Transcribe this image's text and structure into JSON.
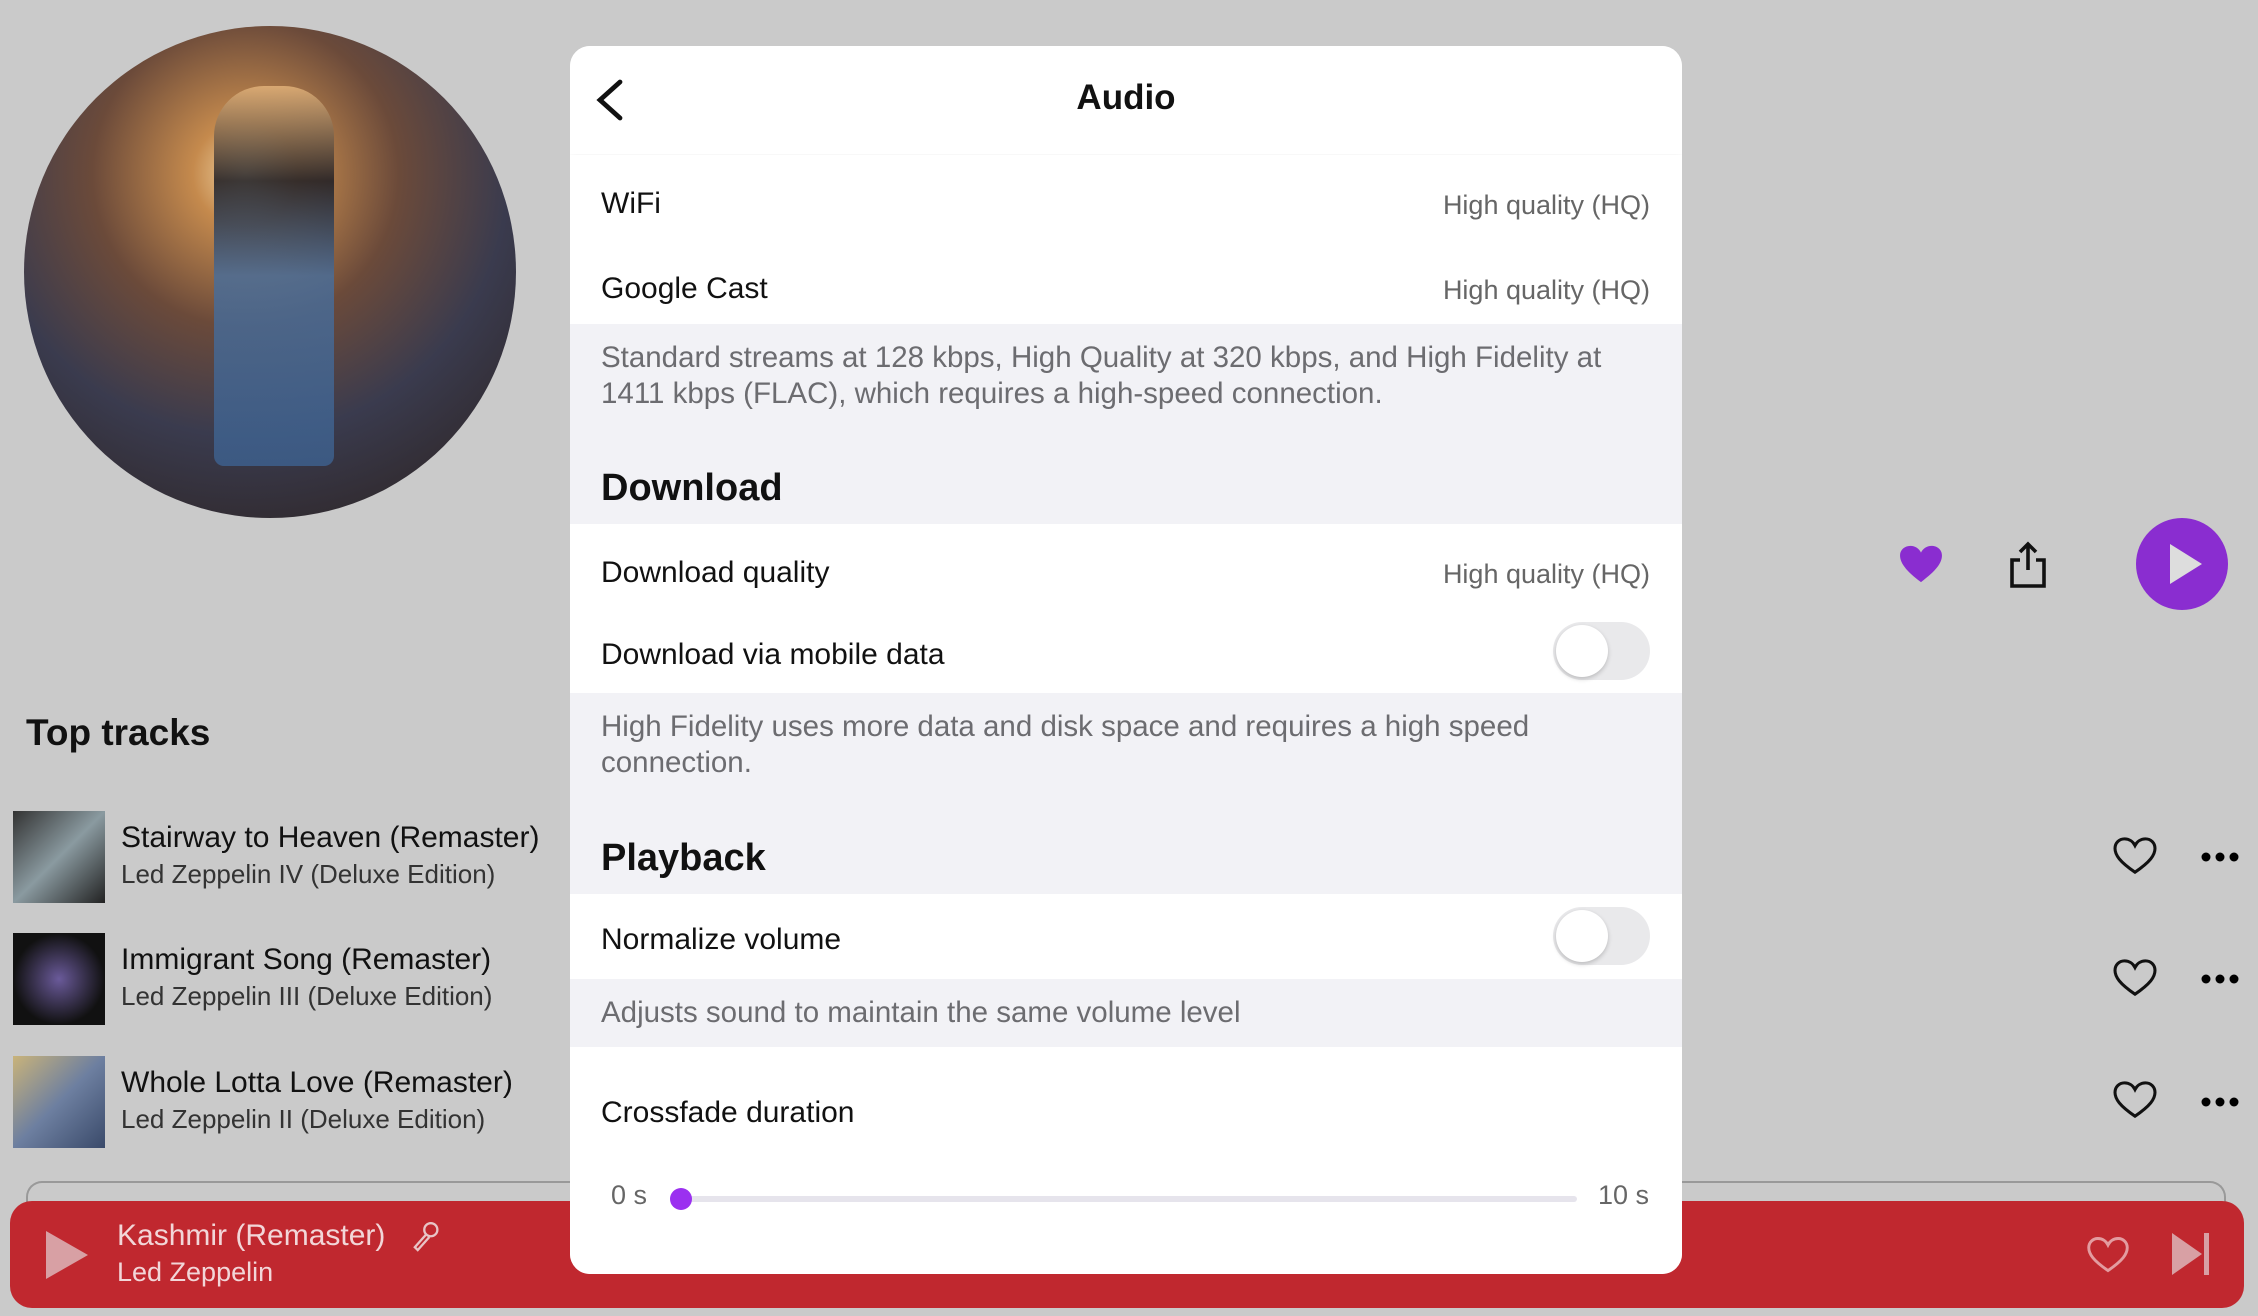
{
  "artist": {
    "actions": {
      "favorite_icon": "heart-filled",
      "share_icon": "share",
      "play_icon": "play"
    },
    "accent": "#8a2dd0"
  },
  "top_tracks": {
    "title": "Top tracks",
    "items": [
      {
        "title": "Stairway to Heaven (Remaster)",
        "album": "Led Zeppelin IV (Deluxe Edition)"
      },
      {
        "title": "Immigrant Song (Remaster)",
        "album": "Led Zeppelin III (Deluxe Edition)"
      },
      {
        "title": "Whole Lotta Love (Remaster)",
        "album": "Led Zeppelin II (Deluxe Edition)"
      }
    ]
  },
  "mini_player": {
    "title": "Kashmir (Remaster)",
    "artist": "Led Zeppelin",
    "color": "#c0282f"
  },
  "modal": {
    "title": "Audio",
    "streaming": [
      {
        "label": "WiFi",
        "value": "High quality (HQ)"
      },
      {
        "label": "Google Cast",
        "value": "High quality (HQ)"
      }
    ],
    "streaming_note": "Standard streams at 128 kbps, High Quality at 320 kbps, and High Fidelity at 1411 kbps (FLAC), which requires a high-speed connection.",
    "download": {
      "title": "Download",
      "quality_label": "Download quality",
      "quality_value": "High quality (HQ)",
      "mobile_label": "Download via mobile data",
      "mobile_on": false,
      "note": "High Fidelity uses more data and disk space and requires a high speed connection."
    },
    "playback": {
      "title": "Playback",
      "normalize_label": "Normalize volume",
      "normalize_on": false,
      "normalize_note": "Adjusts sound to maintain the same volume level",
      "crossfade_label": "Crossfade duration",
      "crossfade_min": "0 s",
      "crossfade_max": "10 s",
      "crossfade_value_s": 0
    }
  }
}
